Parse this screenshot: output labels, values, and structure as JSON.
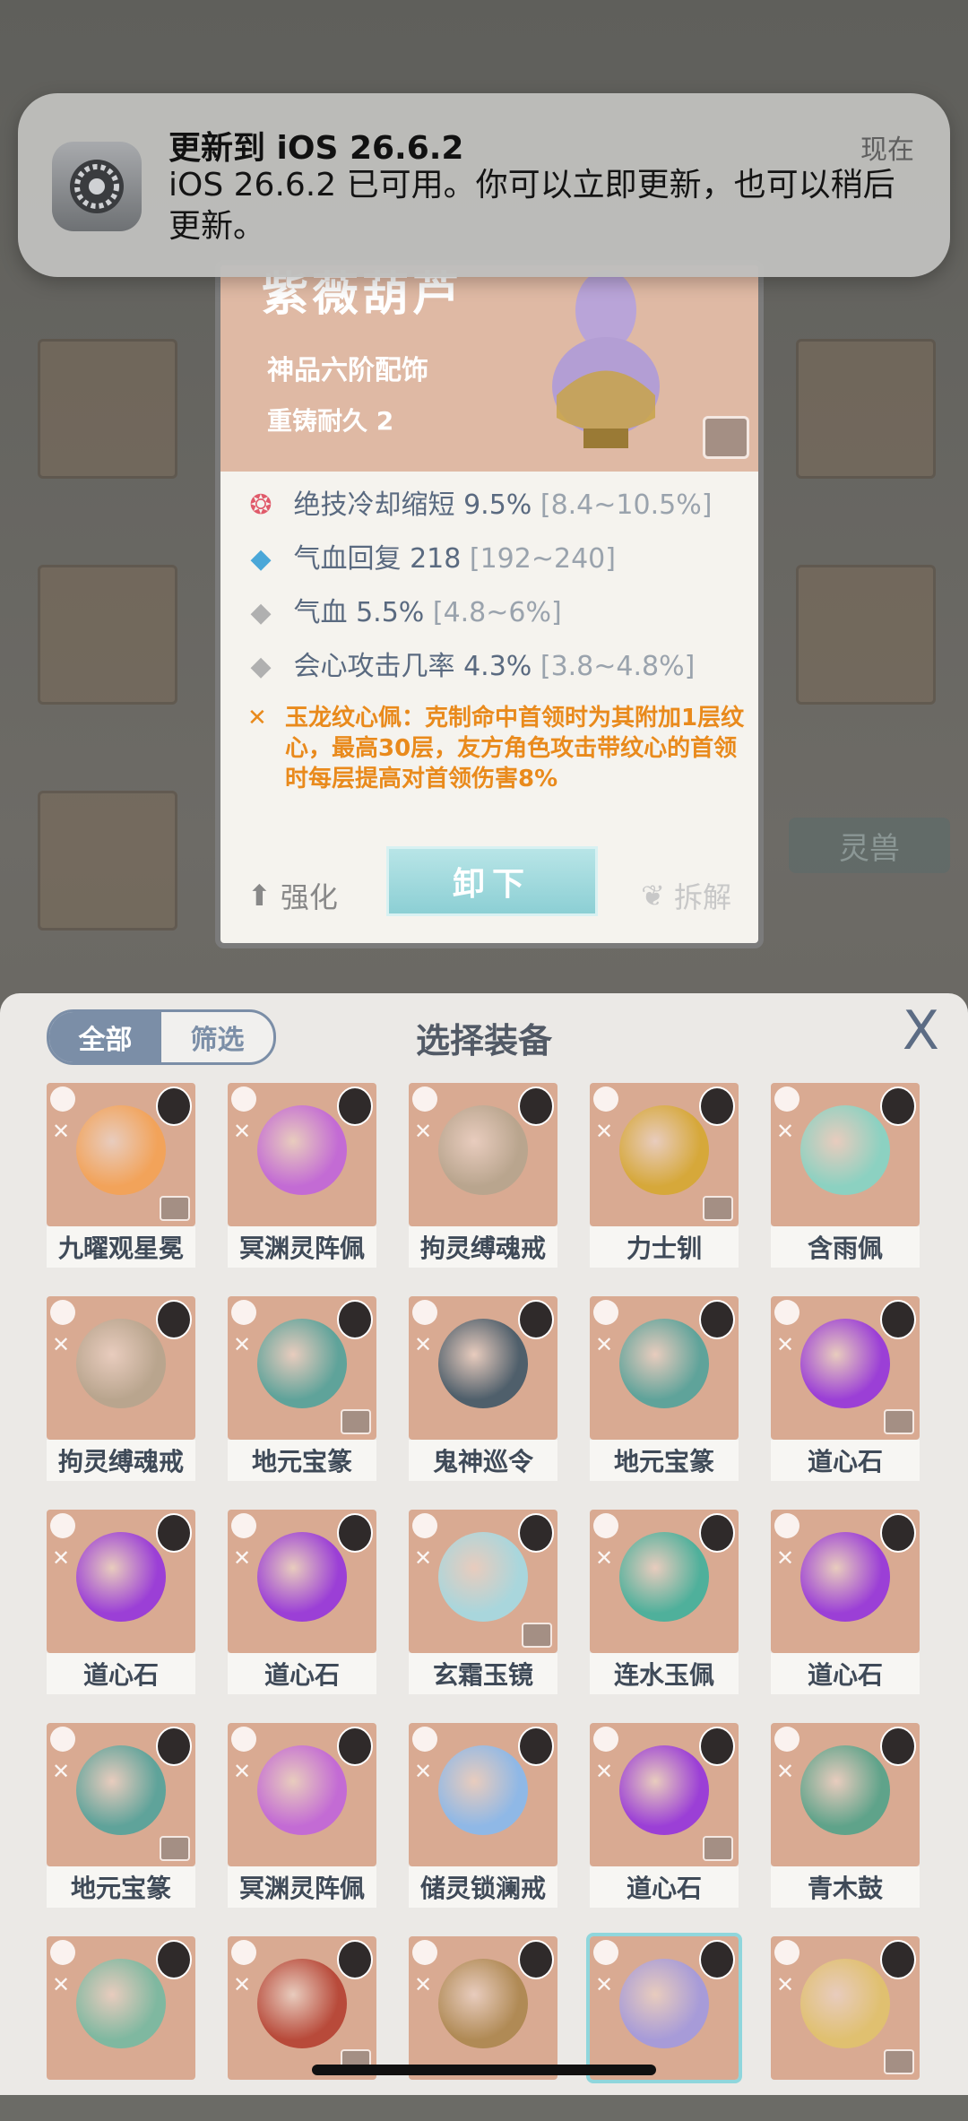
{
  "notification": {
    "title": "更新到 iOS 26.6.2",
    "time": "现在",
    "body": "iOS 26.6.2 已可用。你可以立即更新，也可以稍后更新。",
    "app_icon": "settings-gear-icon"
  },
  "background": {
    "tab_label": "灵兽"
  },
  "detail": {
    "name": "紫薇葫芦",
    "grade": "神品六阶配饰",
    "durability": "重铸耐久 2",
    "stats": [
      {
        "icon": "skill-icon",
        "label": "绝技冷却缩短 9.5%",
        "range": "[8.4~10.5%]"
      },
      {
        "icon": "diamond-blue-icon",
        "label": "气血回复 218",
        "range": "[192~240]"
      },
      {
        "icon": "diamond-grey-icon",
        "label": "气血 5.5%",
        "range": "[4.8~6%]"
      },
      {
        "icon": "diamond-grey-icon",
        "label": "会心攻击几率 4.3%",
        "range": "[3.8~4.8%]"
      }
    ],
    "effect": "玉龙纹心佩：克制命中首领时为其附加1层纹心，最高30层，友方角色攻击带纹心的首领时每层提高对首领伤害8%",
    "enhance": "强化",
    "unload": "卸下",
    "dismantle": "拆解"
  },
  "sheet": {
    "tabs": [
      "全部",
      "筛选"
    ],
    "title": "选择装备",
    "close": "X",
    "items": [
      {
        "name": "九曜观星冕",
        "color": "#f2a35a"
      },
      {
        "name": "冥渊灵阵佩",
        "color": "#c36bd4"
      },
      {
        "name": "拘灵缚魂戒",
        "color": "#b9a58e"
      },
      {
        "name": "力士钏",
        "color": "#d6a83a"
      },
      {
        "name": "含雨佩",
        "color": "#8cd1c1"
      },
      {
        "name": "拘灵缚魂戒",
        "color": "#b9a58e"
      },
      {
        "name": "地元宝篆",
        "color": "#5fa39a"
      },
      {
        "name": "鬼神巡令",
        "color": "#4f5f6b"
      },
      {
        "name": "地元宝篆",
        "color": "#5fa39a"
      },
      {
        "name": "道心石",
        "color": "#9b3fd6"
      },
      {
        "name": "道心石",
        "color": "#9b3fd6"
      },
      {
        "name": "道心石",
        "color": "#9b3fd6"
      },
      {
        "name": "玄霜玉镜",
        "color": "#a9d6dc"
      },
      {
        "name": "连水玉佩",
        "color": "#4fb09b"
      },
      {
        "name": "道心石",
        "color": "#9b3fd6"
      },
      {
        "name": "地元宝篆",
        "color": "#5fa39a"
      },
      {
        "name": "冥渊灵阵佩",
        "color": "#c36bd4"
      },
      {
        "name": "储灵锁澜戒",
        "color": "#8fb8e6"
      },
      {
        "name": "道心石",
        "color": "#9b3fd6"
      },
      {
        "name": "青木鼓",
        "color": "#5fa38a"
      },
      {
        "name": "",
        "color": "#7fb8a0"
      },
      {
        "name": "",
        "color": "#b84a3a"
      },
      {
        "name": "",
        "color": "#b08a55"
      },
      {
        "name": "",
        "color": "#a79bd8"
      },
      {
        "name": "",
        "color": "#e0c070"
      }
    ]
  }
}
